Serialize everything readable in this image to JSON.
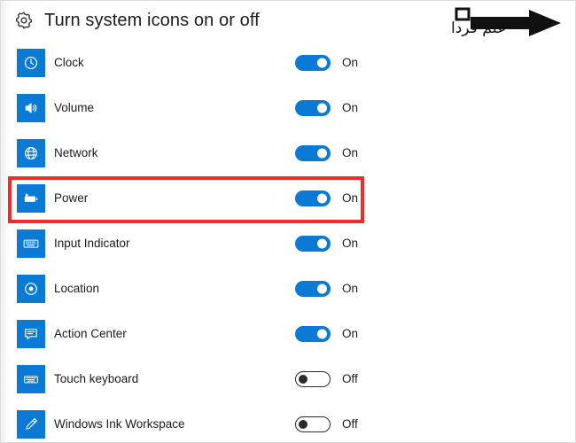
{
  "header": {
    "title": "Turn system icons on or off",
    "gear_icon": "gear-icon"
  },
  "watermark": {
    "text": "علم فردا",
    "arrow_icon": "right-arrow-icon"
  },
  "colors": {
    "accent_blue": "#0b7ad4",
    "highlight_red": "#f42a2a",
    "text": "#1b1b1b",
    "background": "#ffffff"
  },
  "highlight": {
    "target_row": "Power"
  },
  "rows": [
    {
      "label": "Clock",
      "icon": "clock-icon",
      "state": "On",
      "on": true
    },
    {
      "label": "Volume",
      "icon": "speaker-icon",
      "state": "On",
      "on": true
    },
    {
      "label": "Network",
      "icon": "globe-icon",
      "state": "On",
      "on": true
    },
    {
      "label": "Power",
      "icon": "battery-icon",
      "state": "On",
      "on": true
    },
    {
      "label": "Input Indicator",
      "icon": "keyboard-icon",
      "state": "On",
      "on": true
    },
    {
      "label": "Location",
      "icon": "location-icon",
      "state": "On",
      "on": true
    },
    {
      "label": "Action Center",
      "icon": "chat-icon",
      "state": "On",
      "on": true
    },
    {
      "label": "Touch keyboard",
      "icon": "touch-keyboard-icon",
      "state": "Off",
      "on": false
    },
    {
      "label": "Windows Ink Workspace",
      "icon": "pen-icon",
      "state": "Off",
      "on": false
    }
  ]
}
